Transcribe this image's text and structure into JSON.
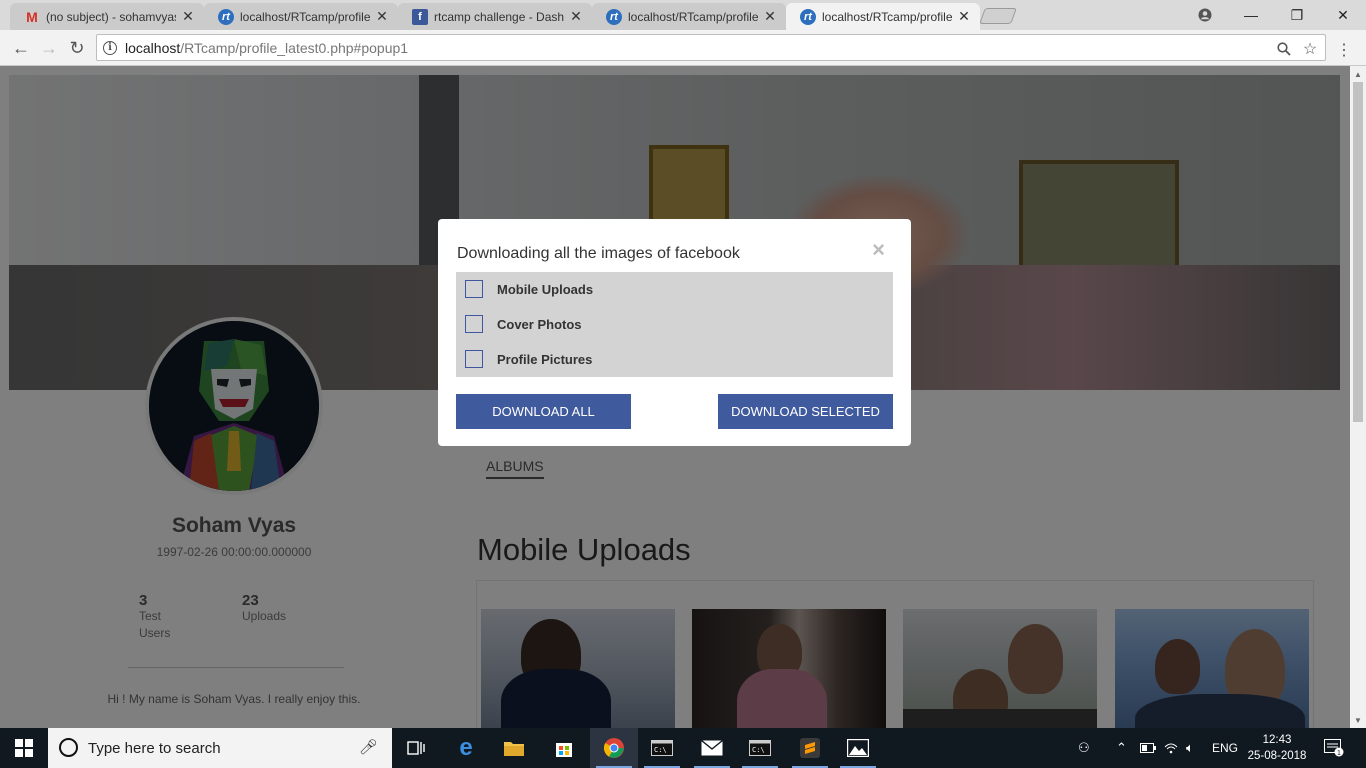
{
  "browser": {
    "tabs": [
      {
        "title": "(no subject) - sohamvyas",
        "favicon": "gmail-icon"
      },
      {
        "title": "localhost/RTcamp/profile",
        "favicon": "rtcamp-icon"
      },
      {
        "title": "rtcamp challenge - Dashb",
        "favicon": "facebook-icon"
      },
      {
        "title": "localhost/RTcamp/profile",
        "favicon": "rtcamp-icon"
      },
      {
        "title": "localhost/RTcamp/profile",
        "favicon": "rtcamp-icon",
        "active": true
      }
    ],
    "url_host": "localhost",
    "url_path": "/RTcamp/profile_latest0.php#popup1"
  },
  "profile": {
    "name": "Soham Vyas",
    "dob": "1997-02-26 00:00:00.000000",
    "stats": [
      {
        "value": "3",
        "label": "Test Users"
      },
      {
        "value": "23",
        "label": "Uploads"
      }
    ],
    "bio": "Hi ! My name is Soham Vyas. I really enjoy this."
  },
  "main": {
    "tab_label": "ALBUMS",
    "section_title": "Mobile Uploads"
  },
  "modal": {
    "title": "Downloading all the images of facebook",
    "close_glyph": "×",
    "options": [
      {
        "label": "Mobile Uploads",
        "checked": false
      },
      {
        "label": "Cover Photos",
        "checked": false
      },
      {
        "label": "Profile Pictures",
        "checked": false
      }
    ],
    "download_all_label": "DOWNLOAD ALL",
    "download_selected_label": "DOWNLOAD SELECTED",
    "button_color": "#3f5a9d"
  },
  "taskbar": {
    "search_placeholder": "Type here to search",
    "language": "ENG",
    "time": "12:43",
    "date": "25-08-2018",
    "notification_count": "1"
  }
}
